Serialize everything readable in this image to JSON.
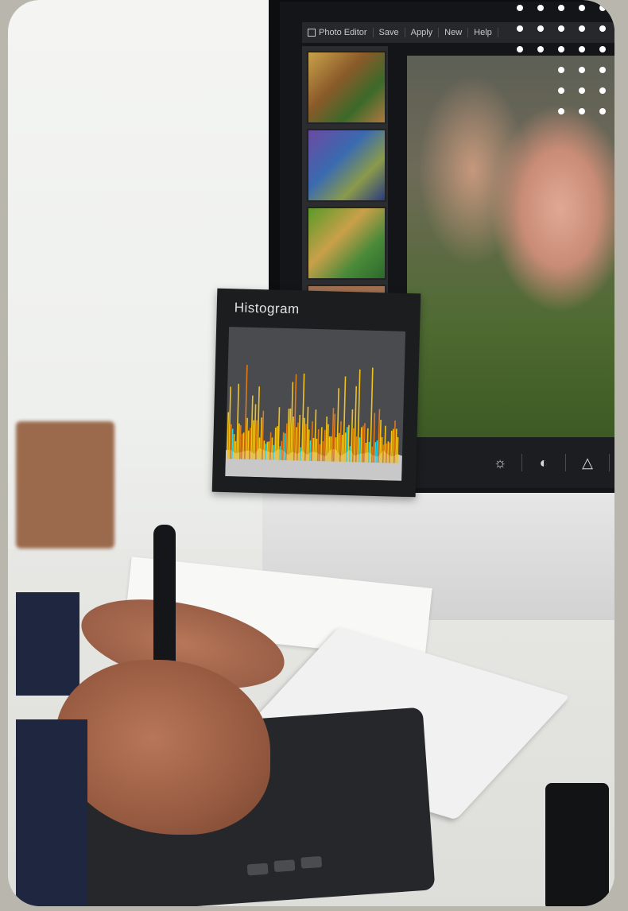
{
  "photo_editor": {
    "menu": {
      "app_label": "Photo Editor",
      "items": [
        "Save",
        "Apply",
        "New",
        "Help"
      ]
    },
    "toolbar_icons": [
      "brightness-icon",
      "contrast-icon",
      "triangle-icon"
    ],
    "toolbar_glyphs": [
      "☼",
      "◐",
      "△"
    ]
  },
  "histogram": {
    "title": "Histogram",
    "colors": {
      "yellow": "#f2c21a",
      "orange": "#e07a1a",
      "cyan": "#2ad8e8",
      "gray": "#c8c8c8",
      "background": "#4a4b4e"
    }
  }
}
